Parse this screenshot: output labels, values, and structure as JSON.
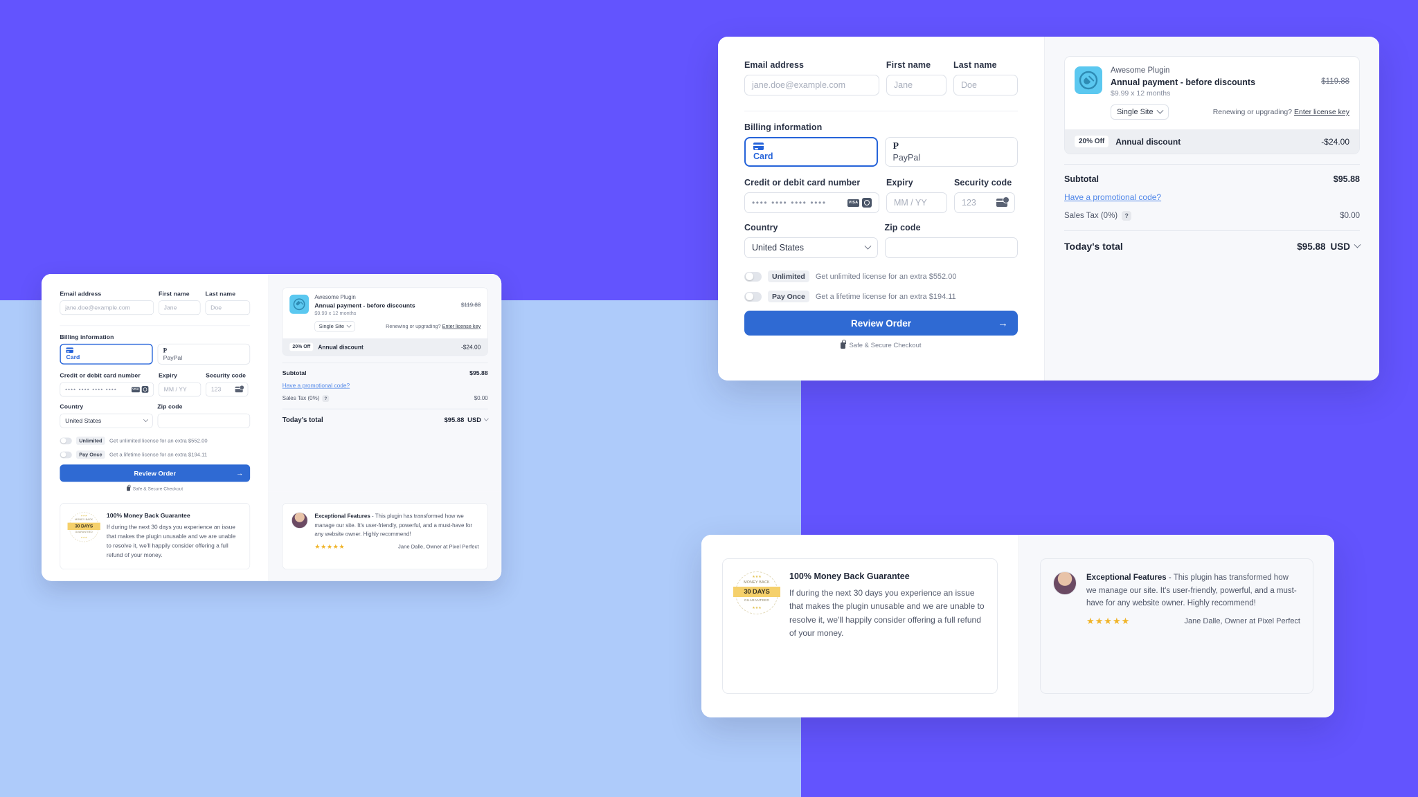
{
  "theme": {
    "purple": "#6354FE",
    "light_blue": "#AECBFA",
    "accent_blue": "#2563D9",
    "button_blue": "#2F6AD3",
    "panel_bg": "#F7F8FB",
    "plugin_icon_bg": "#5BC8F0",
    "star_gold": "#F0B429",
    "seal_band": "#F5D06B"
  },
  "form": {
    "email": {
      "label": "Email address",
      "placeholder": "jane.doe@example.com",
      "value": ""
    },
    "first_name": {
      "label": "First name",
      "placeholder": "Jane",
      "value": ""
    },
    "last_name": {
      "label": "Last name",
      "placeholder": "Doe",
      "value": ""
    },
    "billing_heading": "Billing information",
    "payment_methods": [
      {
        "label": "Card",
        "icon": "credit-card-icon",
        "selected": true
      },
      {
        "label": "PayPal",
        "icon": "paypal-icon",
        "selected": false
      }
    ],
    "card_number": {
      "label": "Credit or debit card number",
      "value": "•••• •••• •••• ••••",
      "brands": [
        "VISA",
        "Diners Club"
      ]
    },
    "expiry": {
      "label": "Expiry",
      "placeholder": "MM / YY",
      "value": ""
    },
    "security_code": {
      "label": "Security code",
      "placeholder": "123",
      "value": ""
    },
    "country": {
      "label": "Country",
      "value": "United States"
    },
    "zip": {
      "label": "Zip code",
      "placeholder": "",
      "value": ""
    },
    "upsells": [
      {
        "chip": "Unlimited",
        "text": "Get unlimited license for an extra $552.00",
        "on": false
      },
      {
        "chip": "Pay Once",
        "text": "Get a lifetime license for an extra $194.11",
        "on": false
      }
    ],
    "submit_label": "Review Order",
    "submit_arrow": "→",
    "secure_note": "Safe & Secure Checkout"
  },
  "summary": {
    "product": {
      "vendor": "Awesome Plugin",
      "title": "Annual payment - before discounts",
      "subtitle": "$9.99 x 12 months",
      "original_price": "$119.88",
      "license_select": "Single Site",
      "renew_text": "Renewing or upgrading?",
      "renew_link": "Enter license key"
    },
    "discount": {
      "badge": "20% Off",
      "label": "Annual discount",
      "amount": "-$24.00"
    },
    "subtotal": {
      "label": "Subtotal",
      "value": "$95.88"
    },
    "promo_link": "Have a promotional code?",
    "tax": {
      "label": "Sales Tax (0%)",
      "help": "?",
      "value": "$0.00"
    },
    "total": {
      "label": "Today's total",
      "value": "$95.88",
      "currency": "USD"
    }
  },
  "guarantee": {
    "heading": "100% Money Back Guarantee",
    "body": "If during the next 30 days you experience an issue that makes the plugin unusable and we are unable to resolve it, we'll happily consider offering a full refund of your money.",
    "seal_top": "MONEY BACK",
    "seal_main": "30 DAYS",
    "seal_bottom": "GUARANTEED"
  },
  "testimonial": {
    "title": "Exceptional Features",
    "dash": " - ",
    "body": "This plugin has transformed how we manage our site. It's user-friendly, powerful, and a must-have for any website owner. Highly recommend!",
    "stars": "★★★★★",
    "author": "Jane Dalle, Owner at Pixel Perfect"
  }
}
